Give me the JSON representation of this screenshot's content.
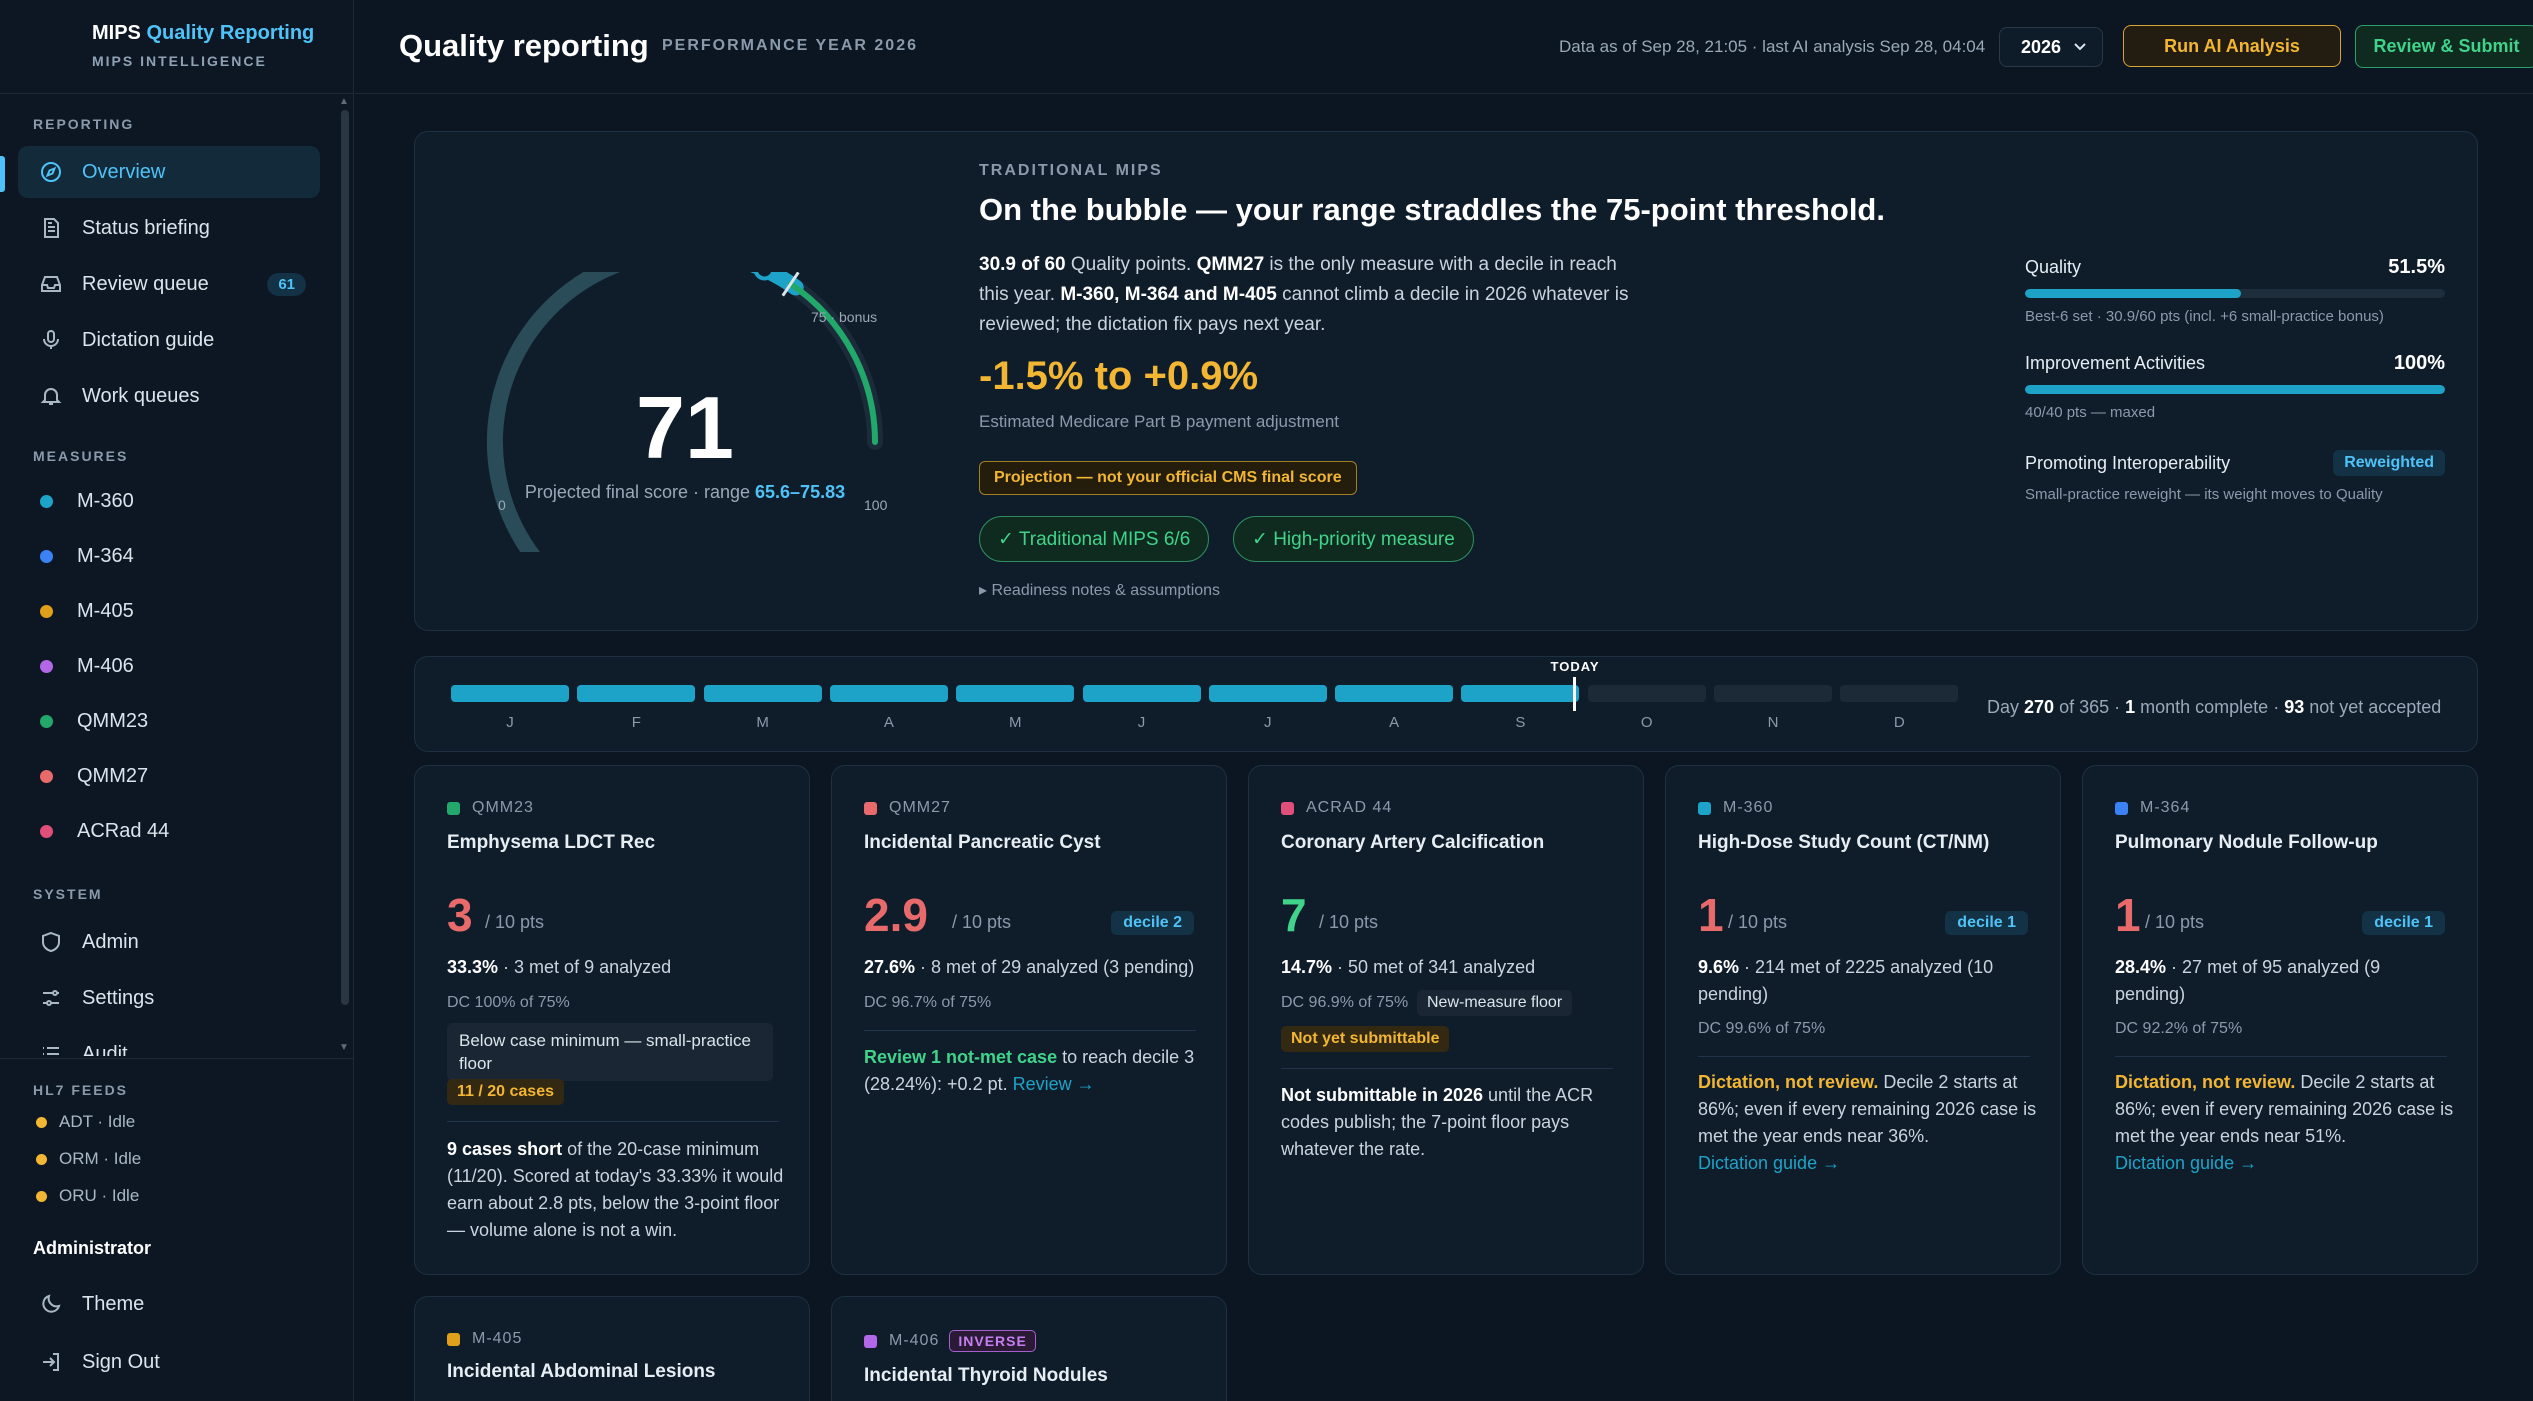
{
  "brand": {
    "title_a": "MIPS",
    "title_b": "Quality Reporting",
    "subtitle": "MIPS INTELLIGENCE"
  },
  "sidebar": {
    "reporting_label": "REPORTING",
    "nav": [
      {
        "label": "Overview",
        "icon": "compass-icon"
      },
      {
        "label": "Status briefing",
        "icon": "document-icon"
      },
      {
        "label": "Review queue",
        "icon": "inbox-icon",
        "badge": "61"
      },
      {
        "label": "Dictation guide",
        "icon": "microphone-icon"
      },
      {
        "label": "Work queues",
        "icon": "bell-icon"
      }
    ],
    "measures_label": "MEASURES",
    "measures": [
      {
        "label": "M-360",
        "color": "#1ea3c8"
      },
      {
        "label": "M-364",
        "color": "#3b82f6"
      },
      {
        "label": "M-405",
        "color": "#e0a019"
      },
      {
        "label": "M-406",
        "color": "#b267e6"
      },
      {
        "label": "QMM23",
        "color": "#22a86a"
      },
      {
        "label": "QMM27",
        "color": "#e86a6a"
      },
      {
        "label": "ACRad 44",
        "color": "#e04e7a"
      }
    ],
    "system_label": "SYSTEM",
    "system": [
      {
        "label": "Admin",
        "icon": "shield-icon"
      },
      {
        "label": "Settings",
        "icon": "sliders-icon"
      },
      {
        "label": "Audit",
        "icon": "list-icon"
      }
    ],
    "feeds_label": "HL7 FEEDS",
    "feeds": [
      "ADT · Idle",
      "ORM · Idle",
      "ORU · Idle"
    ],
    "user_label": "Administrator",
    "theme_label": "Theme",
    "signout_label": "Sign Out"
  },
  "header": {
    "title": "Quality reporting",
    "subtitle": "PERFORMANCE YEAR 2026",
    "as_of": "Data as of Sep 28, 21:05 · last AI analysis Sep 28, 04:04",
    "year": "2026",
    "run_ai": "Run AI Analysis",
    "review_submit": "Review & Submit"
  },
  "hero": {
    "score": "71",
    "score_value": 71,
    "gauge_min": "0",
    "gauge_max": "100",
    "bonus_label": "75 · bonus",
    "bonus_value": 75,
    "range_low": 65.6,
    "range_high": 75.83,
    "caption": "Projected final score · range ",
    "range": "65.6–75.83",
    "section_label": "TRADITIONAL MIPS",
    "headline": "On the bubble — your range straddles the 75-point threshold.",
    "desc_1": "30.9 of 60",
    "desc_2": " Quality points. ",
    "desc_3": "QMM27",
    "desc_4": " is the only measure with a decile in reach this year. ",
    "desc_5": "M-360, M-364 and M-405",
    "desc_6": " cannot climb a decile in 2026 whatever is reviewed; the dictation fix pays next year.",
    "payment": "-1.5% to +0.9%",
    "payment_caption": "Estimated Medicare Part B payment adjustment",
    "projection_pill": "Projection — not your official CMS final score",
    "pill_1": "✓ Traditional MIPS 6/6",
    "pill_2": "✓ High-priority measure",
    "notes": "▸ Readiness notes & assumptions",
    "categories": [
      {
        "name": "Quality",
        "pct": "51.5%",
        "fill": 0.515,
        "sub": "Best-6 set · 30.9/60 pts (incl. +6 small-practice bonus)"
      },
      {
        "name": "Improvement Activities",
        "pct": "100%",
        "fill": 1.0,
        "sub": "40/40 pts — maxed"
      },
      {
        "name": "Promoting Interoperability",
        "badge": "Reweighted",
        "sub": "Small-practice reweight — its weight moves to Quality"
      }
    ]
  },
  "timeline": {
    "months": [
      "J",
      "F",
      "M",
      "A",
      "M",
      "J",
      "J",
      "A",
      "S",
      "O",
      "N",
      "D"
    ],
    "complete_through": 9,
    "today_fraction": 0.74,
    "today_label": "TODAY",
    "status_1": "Day ",
    "day": "270",
    "status_2": " of 365 · ",
    "months_complete": "1",
    "status_3": " month complete · ",
    "not_accepted": "93",
    "status_4": " not yet accepted"
  },
  "cards": {
    "qmm23": {
      "code": "QMM23",
      "color": "#22a86a",
      "title": "Emphysema LDCT Rec",
      "score": "3",
      "outof": "/ 10 pts",
      "score_color": "#e86a6a",
      "rate_b": "33.3%",
      "rate": " · 3 met of 9 analyzed",
      "dc": "DC 100% of 75%",
      "note": "Below case minimum — small-practice floor",
      "tag": "11 / 20 cases",
      "body_b": "9 cases short",
      "body": " of the 20-case minimum (11/20). Scored at today's 33.33% it would earn about 2.8 pts, below the 3-point floor — volume alone is not a win."
    },
    "qmm27": {
      "code": "QMM27",
      "color": "#e86a6a",
      "title": "Incidental Pancreatic Cyst",
      "score": "2.9",
      "outof": "/ 10 pts",
      "score_color": "#e86a6a",
      "decile": "decile 2",
      "rate_b": "27.6%",
      "rate": " · 8 met of 29 analyzed (3 pending)",
      "dc": "DC 96.7% of 75%",
      "body_g": "Review 1 not-met case",
      "body": " to reach decile 3 (28.24%): +0.2 pt. ",
      "link": "Review →"
    },
    "acrad44": {
      "code": "ACRAD 44",
      "color": "#e04e7a",
      "title": "Coronary Artery Calcification",
      "score": "7",
      "outof": "/ 10 pts",
      "score_color": "#3fd48a",
      "rate_b": "14.7%",
      "rate": " · 50 met of 341 analyzed",
      "dc": "DC 96.9% of 75%",
      "floor_tag": "New-measure floor",
      "submit_tag": "Not yet submittable",
      "body_b": "Not submittable in 2026",
      "body": " until the ACR codes publish; the 7-point floor pays whatever the rate."
    },
    "m360": {
      "code": "M-360",
      "color": "#1ea3c8",
      "title": "High-Dose Study Count (CT/NM)",
      "score": "1",
      "outof": "/ 10 pts",
      "score_color": "#e86a6a",
      "decile": "decile 1",
      "rate_b": "9.6%",
      "rate": " · 214 met of 2225 analyzed (10 pending)",
      "dc": "DC 99.6% of 75%",
      "body_a": "Dictation, not review.",
      "body": " Decile 2 starts at 86%; even if every remaining 2026 case is met the year ends near 36%.",
      "link": "Dictation guide →"
    },
    "m364": {
      "code": "M-364",
      "color": "#3b82f6",
      "title": "Pulmonary Nodule Follow-up",
      "score": "1",
      "outof": "/ 10 pts",
      "score_color": "#e86a6a",
      "decile": "decile 1",
      "rate_b": "28.4%",
      "rate": " · 27 met of 95 analyzed (9 pending)",
      "dc": "DC 92.2% of 75%",
      "body_a": "Dictation, not review.",
      "body": " Decile 2 starts at 86%; even if every remaining 2026 case is met the year ends near 51%.",
      "link": "Dictation guide →"
    },
    "m405": {
      "code": "M-405",
      "color": "#e0a019",
      "title": "Incidental Abdominal Lesions"
    },
    "m406": {
      "code": "M-406",
      "color": "#b267e6",
      "title": "Incidental Thyroid Nodules",
      "tag": "INVERSE"
    }
  }
}
